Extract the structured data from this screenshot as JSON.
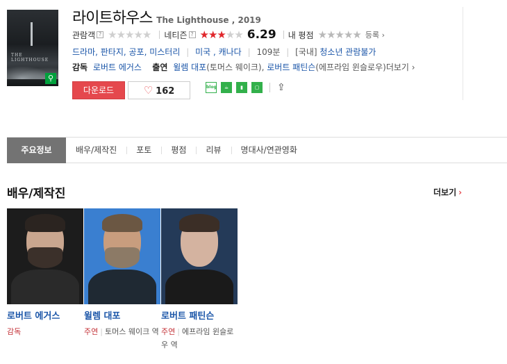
{
  "movie": {
    "title": "라이트하우스",
    "title_sub": "The Lighthouse , 2019",
    "poster_text": "THE LIGHTHOUSE",
    "audience_label": "관람객",
    "netizen_label": "네티즌",
    "netizen_score": "6.29",
    "netizen_rating_stars": 3,
    "my_rating_label": "내 평점",
    "register_label": "등록 ›",
    "genres": "드라마, 판타지, 공포, 미스터리",
    "country": "미국 , 캐나다",
    "runtime": "109분",
    "rating_prefix": "[국내]",
    "rating_grade": "청소년 관람불가",
    "director_label": "감독",
    "director": "로버트 에거스",
    "cast_label": "출연",
    "cast_1": "윌렘 대포",
    "cast_1_role": "(토머스 웨이크),",
    "cast_2": "로버트 패틴슨",
    "cast_2_role": "(에프라임 윈슬로우)",
    "more_label": "더보기 ›"
  },
  "actions": {
    "download": "다운로드",
    "like_count": "162",
    "share_icons": [
      "blog-icon",
      "cafe-icon",
      "bookmark-icon",
      "memo-icon",
      "share-icon"
    ]
  },
  "tabs": [
    "주요정보",
    "배우/제작진",
    "포토",
    "평점",
    "리뷰",
    "명대사/연관영화"
  ],
  "cast_section": {
    "title": "배우/제작진",
    "more": "더보기",
    "people": [
      {
        "name": "로버트 에거스",
        "role": "감독",
        "character": ""
      },
      {
        "name": "윌렘 대포",
        "role": "주연",
        "character": "토머스 웨이크 역"
      },
      {
        "name": "로버트 패틴슨",
        "role": "주연",
        "character": "에프라임 윈슬로우 역"
      }
    ]
  },
  "colors": {
    "accent_red": "#e5484d",
    "link_blue": "#1a55a8",
    "tab_active": "#737373"
  }
}
